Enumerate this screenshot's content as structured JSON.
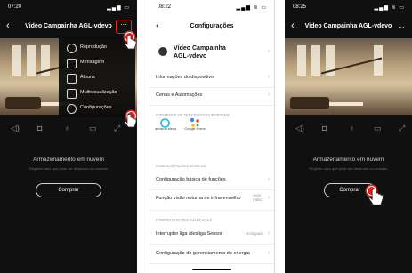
{
  "screen1": {
    "status_time": "07:20",
    "status_icons": "▂▄▆ ▭",
    "back_label": "‹",
    "title": "Video Campainha AGL-vdevo",
    "more_label": "···",
    "menu": [
      "Reprodução",
      "Mensagem",
      "Álbuns",
      "Multivisualização",
      "Configurações"
    ],
    "menu_icons": [
      "play-icon",
      "message-icon",
      "album-icon",
      "multiview-icon",
      "gear-icon"
    ],
    "controls": [
      "speaker-icon",
      "camera-icon",
      "microphone-icon",
      "record-icon",
      "fullscreen-icon"
    ],
    "cloud_title": "Armazenamento em nuvem",
    "cloud_sub": "Registre caso que pode ser destruído ou roubado",
    "buy_label": "Comprar"
  },
  "screen2": {
    "status_time": "08:22",
    "status_icons": "▂▄▆ ≋ ▭",
    "back_label": "‹",
    "title": "Configurações",
    "device_name_line1": "Vídeo Campainha",
    "device_name_line2": "AGL-vdevo",
    "rows_top": [
      "Informações do dispositivo",
      "Cenas e Automações"
    ],
    "section_third": "CONTROLE DE TERCEIROS SUPORTADO",
    "brand_alexa": "amazon alexa",
    "brand_google": "Google Home",
    "section_basic": "CONFIGURAÇÕES BÁSICAS",
    "row_basic": "Configuração básica de funções",
    "row_ir": "Função visão noturna de infravermelho",
    "row_ir_value": "Auto mátic",
    "section_adv": "CONFIGURAÇÕES AVANÇADAS",
    "row_switch": "Interruptor liga /desliga Sensor",
    "row_switch_value": "Desligado",
    "row_power": "Configuração de gerenciamento de energia"
  },
  "screen3": {
    "status_time": "08:25",
    "status_icons": "▂▄▆ ≋ ▭",
    "back_label": "‹",
    "title": "Video Campainha AGL-vdevo",
    "cloud_title": "Armazenamento em nuvem",
    "cloud_sub": "Registre caso que pode ser destruído ou roubado",
    "buy_label": "Comprar"
  },
  "chevron": "›",
  "colors": {
    "tap_red": "#e21d1d",
    "dark_bg": "#101010"
  }
}
